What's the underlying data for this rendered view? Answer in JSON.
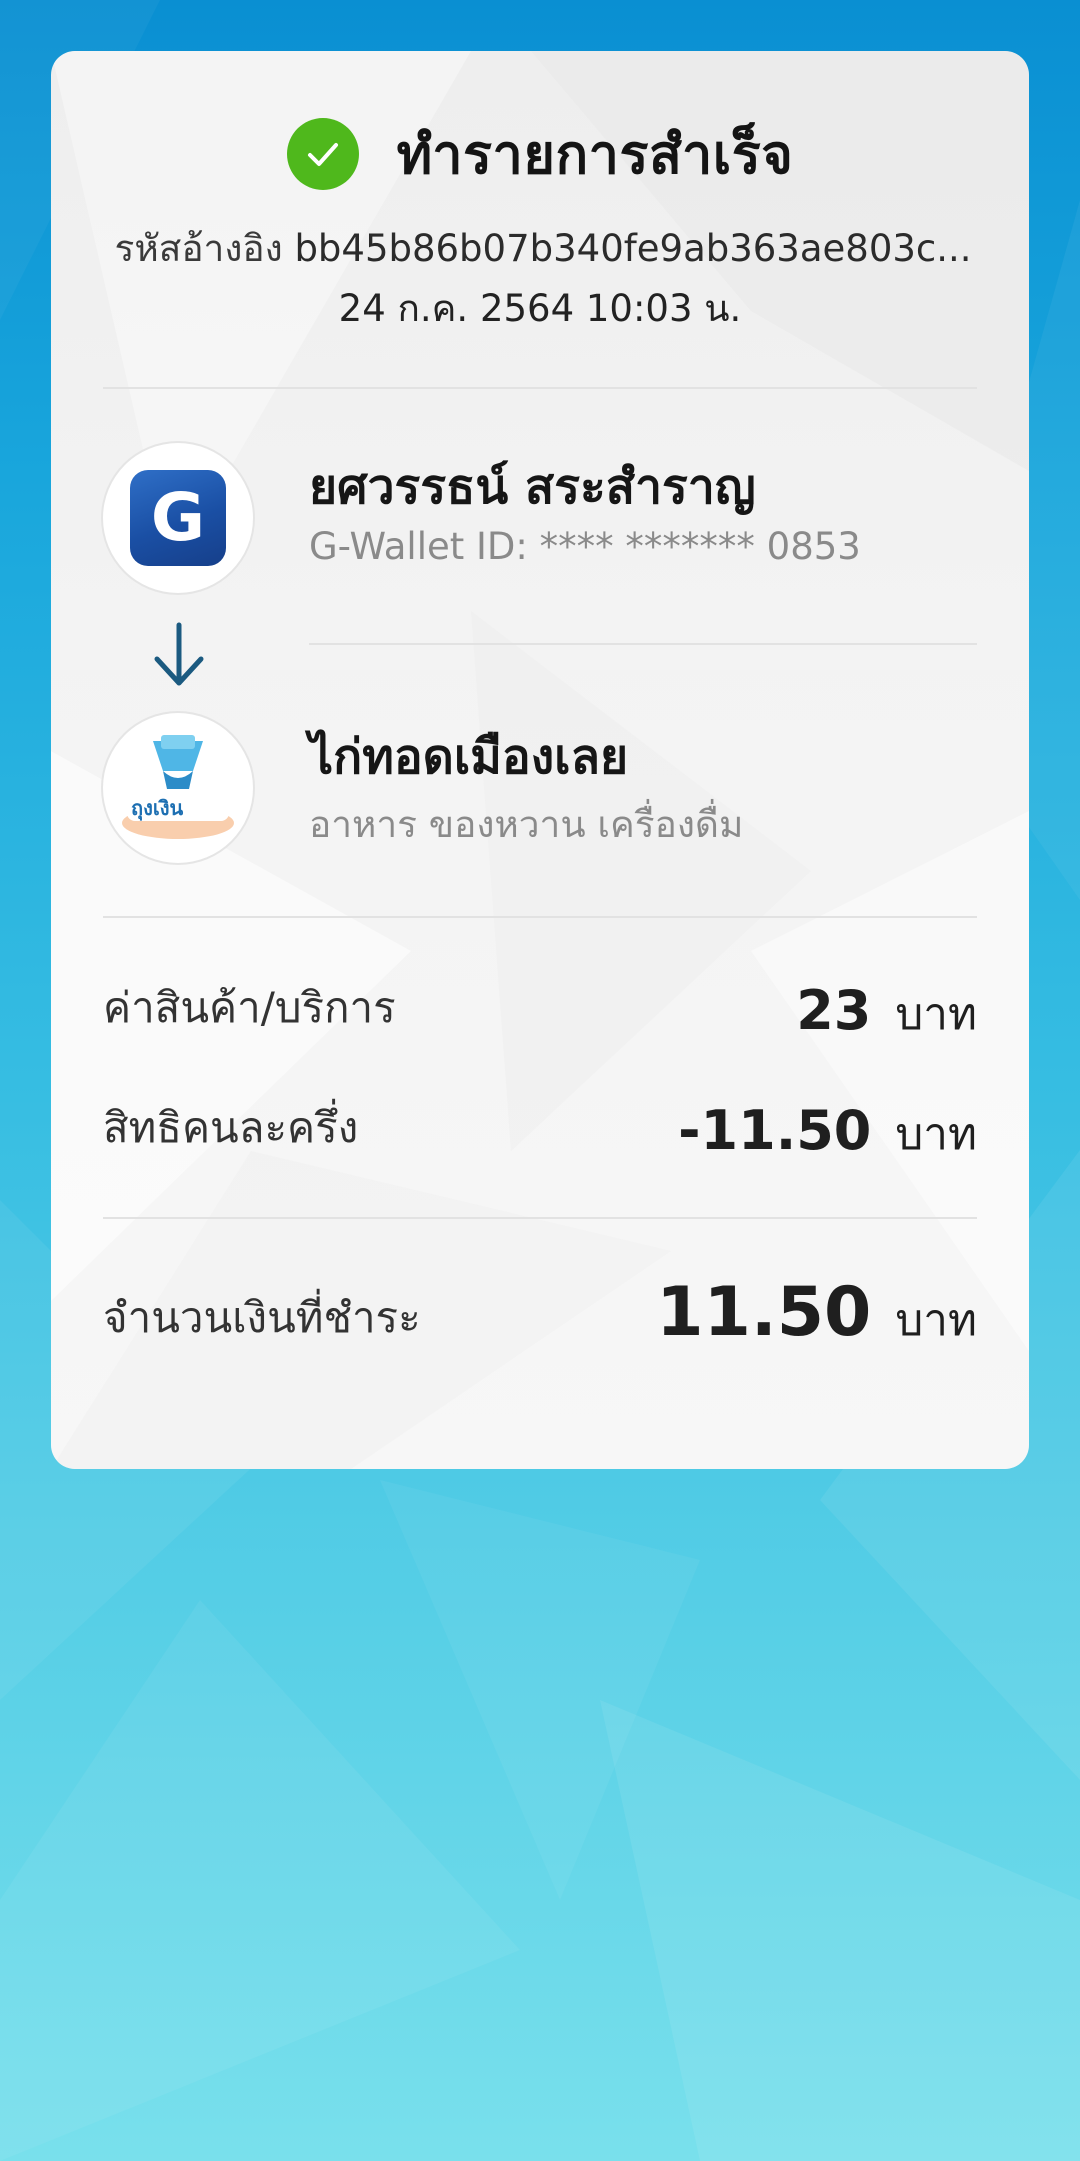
{
  "status": {
    "title": "ทำรายการสำเร็จ"
  },
  "reference": {
    "label": "รหัสอ้างอิง",
    "value": "bb45b86b07b340fe9ab363ae803c..."
  },
  "datetime": "24 ก.ค. 2564 10:03 น.",
  "sender": {
    "name": "ยศวรรธน์ สระสำราญ",
    "wallet_id": "G-Wallet ID: **** ******* 0853",
    "logo_letter": "G"
  },
  "receiver": {
    "name": "ไก่ทอดเมืองเลย",
    "category": "อาหาร ของหวาน เครื่องดื่ม",
    "logo_text": "ถุงเงิน"
  },
  "lines": {
    "price": {
      "label": "ค่าสินค้า/บริการ",
      "amount": "23",
      "unit": "บาท"
    },
    "subsidy": {
      "label": "สิทธิคนละครึ่ง",
      "amount": "-11.50",
      "unit": "บาท"
    },
    "total": {
      "label": "จำนวนเงินที่ชำระ",
      "amount": "11.50",
      "unit": "บาท"
    }
  },
  "colors": {
    "success": "#4fb81c",
    "gwallet": "#1a4fa4",
    "arrow": "#1b5a80"
  },
  "icons": {
    "status": "check-circle-icon",
    "flow": "arrow-down-icon"
  }
}
